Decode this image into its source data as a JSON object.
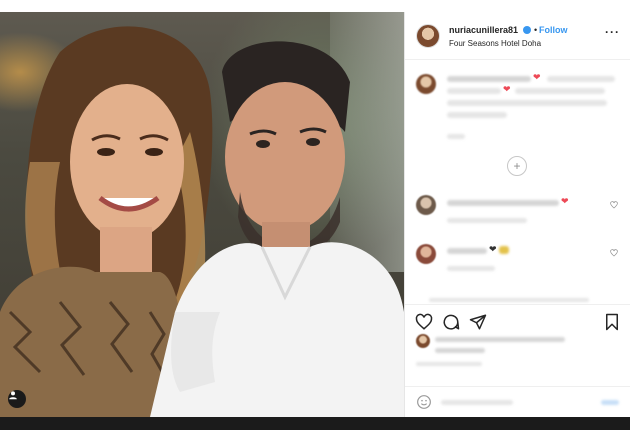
{
  "post": {
    "username": "nuriacunillera81",
    "follow_label": "Follow",
    "bullet": "•",
    "location": "Four Seasons Hotel Doha",
    "more_label": "···"
  },
  "icons": {
    "header": [
      "more-icon",
      "verified-badge-icon"
    ],
    "actions": [
      "heart-icon",
      "comment-icon",
      "share-icon",
      "bookmark-icon"
    ],
    "photo": [
      "user-tag-icon"
    ],
    "comments": [
      "load-more-icon",
      "heart-icon",
      "emoji-icon"
    ]
  },
  "colors": {
    "accent": "#3897f0",
    "like": "#ed4956",
    "text": "#262626",
    "muted": "#8e8e8e"
  }
}
